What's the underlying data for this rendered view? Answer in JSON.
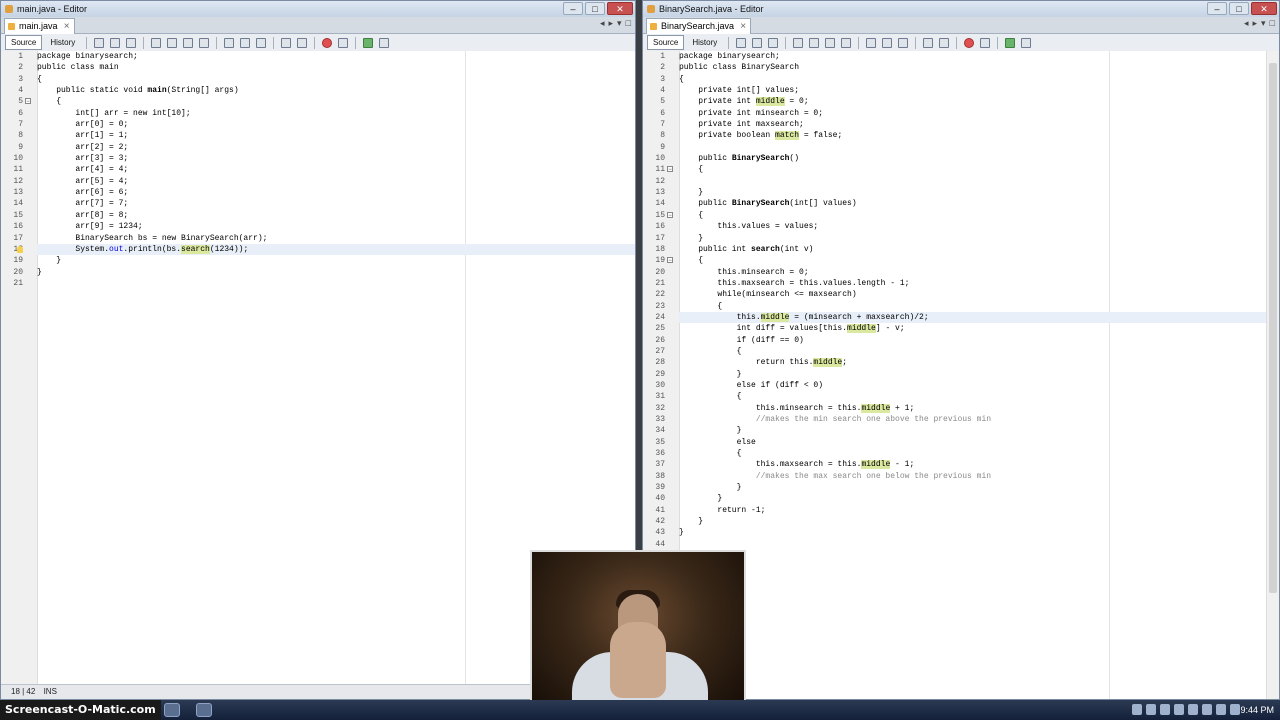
{
  "left_window": {
    "title": "main.java - Editor",
    "tab": "main.java",
    "toolbar": {
      "source": "Source",
      "history": "History"
    },
    "cursor_pos": "18 | 42",
    "insert_mode": "INS",
    "lines": [
      [
        {
          "t": "package binarysearch;"
        }
      ],
      [
        {
          "t": "public class main"
        }
      ],
      [
        {
          "t": "{"
        }
      ],
      [
        {
          "t": "    public static void "
        },
        {
          "t": "main",
          "b": true
        },
        {
          "t": "(String[] args)"
        }
      ],
      [
        {
          "t": "    {"
        }
      ],
      [
        {
          "t": "        int[] arr = new int[10];"
        }
      ],
      [
        {
          "t": "        arr[0] = 0;"
        }
      ],
      [
        {
          "t": "        arr[1] = 1;"
        }
      ],
      [
        {
          "t": "        arr[2] = 2;"
        }
      ],
      [
        {
          "t": "        arr[3] = 3;"
        }
      ],
      [
        {
          "t": "        arr[4] = 4;"
        }
      ],
      [
        {
          "t": "        arr[5] = 4;"
        }
      ],
      [
        {
          "t": "        arr[6] = 6;"
        }
      ],
      [
        {
          "t": "        arr[7] = 7;"
        }
      ],
      [
        {
          "t": "        arr[8] = 8;"
        }
      ],
      [
        {
          "t": "        arr[9] = 1234;"
        }
      ],
      [
        {
          "t": "        BinarySearch bs = new BinarySearch(arr);"
        }
      ],
      [
        {
          "t": "        System."
        },
        {
          "t": "out",
          "c": "kw"
        },
        {
          "t": ".println(bs."
        },
        {
          "t": "search",
          "c": "hl"
        },
        {
          "t": "(1234));"
        }
      ],
      [
        {
          "t": "    }"
        }
      ],
      [
        {
          "t": "}"
        }
      ],
      [
        {
          "t": ""
        }
      ]
    ]
  },
  "right_window": {
    "title": "BinarySearch.java - Editor",
    "tab": "BinarySearch.java",
    "toolbar": {
      "source": "Source",
      "history": "History"
    },
    "lines": [
      [
        {
          "t": "package binarysearch;"
        }
      ],
      [
        {
          "t": "public class BinarySearch"
        }
      ],
      [
        {
          "t": "{"
        }
      ],
      [
        {
          "t": "    private int[] values;"
        }
      ],
      [
        {
          "t": "    private int "
        },
        {
          "t": "middle",
          "c": "hl"
        },
        {
          "t": " = 0;"
        }
      ],
      [
        {
          "t": "    private int minsearch = 0;"
        }
      ],
      [
        {
          "t": "    private int maxsearch;"
        }
      ],
      [
        {
          "t": "    private boolean "
        },
        {
          "t": "match",
          "c": "hl"
        },
        {
          "t": " = false;"
        }
      ],
      [
        {
          "t": ""
        }
      ],
      [
        {
          "t": "    public "
        },
        {
          "t": "BinarySearch",
          "b": true
        },
        {
          "t": "()"
        }
      ],
      [
        {
          "t": "    {"
        }
      ],
      [
        {
          "t": ""
        }
      ],
      [
        {
          "t": "    }"
        }
      ],
      [
        {
          "t": "    public "
        },
        {
          "t": "BinarySearch",
          "b": true
        },
        {
          "t": "(int[] values)"
        }
      ],
      [
        {
          "t": "    {"
        }
      ],
      [
        {
          "t": "        this.values = values;"
        }
      ],
      [
        {
          "t": "    }"
        }
      ],
      [
        {
          "t": "    public int "
        },
        {
          "t": "search",
          "b": true
        },
        {
          "t": "(int v)"
        }
      ],
      [
        {
          "t": "    {"
        }
      ],
      [
        {
          "t": "        this.minsearch = 0;"
        }
      ],
      [
        {
          "t": "        this.maxsearch = this.values.length - 1;"
        }
      ],
      [
        {
          "t": "        while(minsearch <= maxsearch)"
        }
      ],
      [
        {
          "t": "        {"
        }
      ],
      [
        {
          "t": "            this."
        },
        {
          "t": "middle",
          "c": "hl"
        },
        {
          "t": " = (minsearch + maxsearch)/2;"
        }
      ],
      [
        {
          "t": "            int diff = values[this."
        },
        {
          "t": "middle",
          "c": "hl"
        },
        {
          "t": "] - v;"
        }
      ],
      [
        {
          "t": "            if (diff == 0)"
        }
      ],
      [
        {
          "t": "            {"
        }
      ],
      [
        {
          "t": "                return this."
        },
        {
          "t": "middle",
          "c": "hl"
        },
        {
          "t": ";"
        }
      ],
      [
        {
          "t": "            }"
        }
      ],
      [
        {
          "t": "            else if (diff < 0)"
        }
      ],
      [
        {
          "t": "            {"
        }
      ],
      [
        {
          "t": "                this.minsearch = this."
        },
        {
          "t": "middle",
          "c": "hl"
        },
        {
          "t": " + 1;"
        }
      ],
      [
        {
          "t": "                //makes the min search one above the previous min",
          "c": "cm"
        }
      ],
      [
        {
          "t": "            }"
        }
      ],
      [
        {
          "t": "            else"
        }
      ],
      [
        {
          "t": "            {"
        }
      ],
      [
        {
          "t": "                this.maxsearch = this."
        },
        {
          "t": "middle",
          "c": "hl"
        },
        {
          "t": " - 1;"
        }
      ],
      [
        {
          "t": "                //makes the max search one below the previous min",
          "c": "cm"
        }
      ],
      [
        {
          "t": "            }"
        }
      ],
      [
        {
          "t": "        }"
        }
      ],
      [
        {
          "t": "        return -1;"
        }
      ],
      [
        {
          "t": "    }"
        }
      ],
      [
        {
          "t": "}"
        }
      ],
      [
        {
          "t": ""
        }
      ]
    ]
  },
  "taskbar": {
    "watermark": "Screencast-O-Matic.com",
    "clock": "9:44 PM"
  }
}
